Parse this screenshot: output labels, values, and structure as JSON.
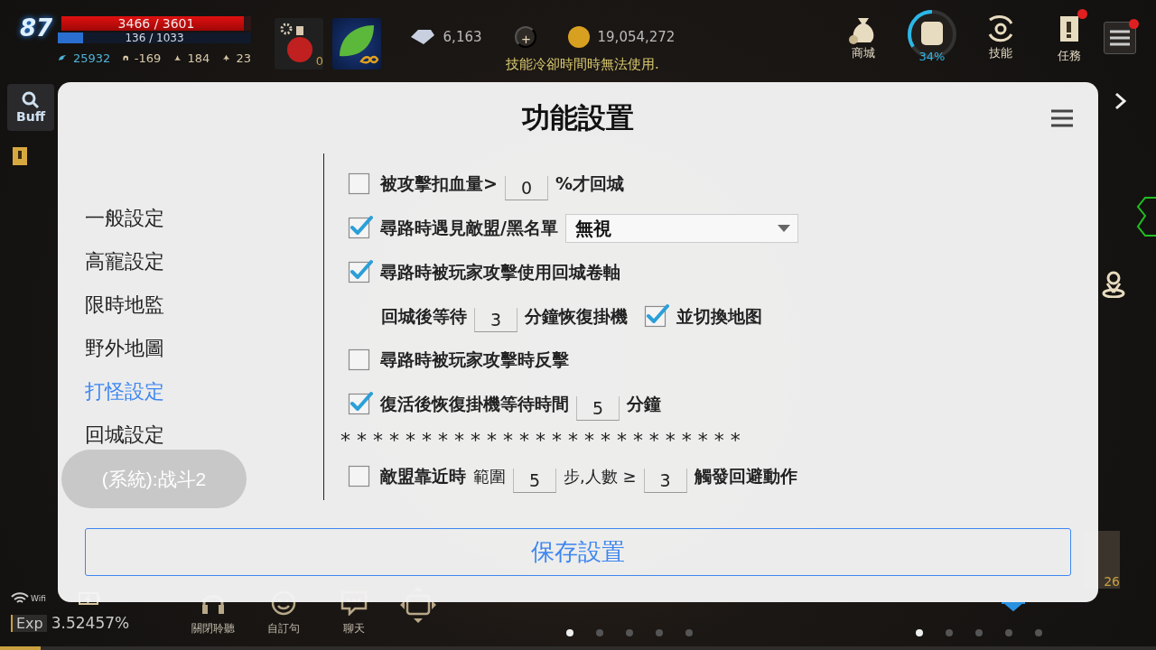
{
  "hud": {
    "level": "87",
    "hp": "3466 / 3601",
    "hp_bar": {
      "level": 0.96
    },
    "mp": "136 / 1033",
    "mp_bar": {
      "level": 0.13
    },
    "stats": [
      "25932",
      "-169",
      "184",
      "23"
    ],
    "potion_count": "0",
    "diamonds": "6,163",
    "plus": "+",
    "gold": "19,054,272",
    "message": "技能冷卻時間時無法使用.",
    "menu": [
      {
        "kind": "shop",
        "label": "商城"
      },
      {
        "kind": "bag",
        "label": "34%",
        "level": 0.34
      },
      {
        "kind": "skill",
        "label": "技能"
      },
      {
        "kind": "quest",
        "label": "任務",
        "alert": true
      },
      {
        "kind": "menu",
        "alert": true
      }
    ],
    "buff": "Buff",
    "slot_count": "26"
  },
  "dialog": {
    "title": "功能設置",
    "sidebar": [
      {
        "label": "一般設定",
        "selected": false
      },
      {
        "label": "高寵設定",
        "selected": false
      },
      {
        "label": "限時地監",
        "selected": false
      },
      {
        "label": "野外地圖",
        "selected": false
      },
      {
        "label": "打怪設定",
        "selected": true
      },
      {
        "label": "回城設定",
        "selected": false
      }
    ],
    "system_button": "(系統):战斗2",
    "rows": [
      {
        "kind": "check",
        "checked": false,
        "parts": [
          {
            "kind": "label",
            "text": "被攻擊扣血量>"
          },
          {
            "kind": "field",
            "value": "0"
          },
          {
            "kind": "label",
            "text": "%才回城"
          }
        ]
      },
      {
        "kind": "check",
        "checked": true,
        "parts": [
          {
            "kind": "label",
            "text": "尋路時遇見敵盟/黑名單"
          },
          {
            "kind": "select",
            "value": "無視"
          }
        ]
      },
      {
        "kind": "check",
        "checked": true,
        "parts": [
          {
            "kind": "label",
            "text": "尋路時被玩家攻擊使用回城卷軸"
          }
        ]
      },
      {
        "kind": "indent",
        "parts": [
          {
            "kind": "label",
            "text": "回城後等待"
          },
          {
            "kind": "field",
            "value": "3"
          },
          {
            "kind": "label",
            "text": "分鐘恢復掛機"
          },
          {
            "kind": "checkbox",
            "checked": true,
            "text": "並切換地图"
          }
        ]
      },
      {
        "kind": "check",
        "checked": false,
        "parts": [
          {
            "kind": "label",
            "text": "尋路時被玩家攻擊時反擊"
          }
        ]
      },
      {
        "kind": "check",
        "checked": true,
        "parts": [
          {
            "kind": "label",
            "text": "復活後恢復掛機等待時間"
          },
          {
            "kind": "field",
            "value": "5"
          },
          {
            "kind": "label",
            "text": "分鐘"
          }
        ]
      },
      {
        "kind": "divider",
        "text": "* * * * * * * * * * * * * * * * * * * * * * * * *"
      },
      {
        "kind": "check",
        "checked": false,
        "parts": [
          {
            "kind": "label",
            "text": "敵盟靠近時"
          },
          {
            "kind": "note",
            "text": "範圍"
          },
          {
            "kind": "field",
            "value": "5"
          },
          {
            "kind": "note",
            "text": "步,人數 ≥"
          },
          {
            "kind": "field",
            "value": "3"
          },
          {
            "kind": "label",
            "text": "觸發回避動作"
          }
        ]
      }
    ],
    "save_button": "保存設置"
  },
  "footer": {
    "wifi": "Wifi",
    "exp_label": "Exp",
    "exp_value": "3.52457%",
    "exp_bar": {
      "level": 0.035
    },
    "actions": [
      {
        "kind": "headset",
        "label": "關閉聆聽"
      },
      {
        "kind": "smile",
        "label": "自訂句"
      },
      {
        "kind": "chat",
        "label": "聊天"
      }
    ],
    "left_pages": [
      {
        "selected": true
      },
      {
        "selected": false
      },
      {
        "selected": false
      },
      {
        "selected": false
      },
      {
        "selected": false
      }
    ],
    "right_pages": [
      {
        "selected": true
      },
      {
        "selected": false
      },
      {
        "selected": false
      },
      {
        "selected": false
      },
      {
        "selected": false
      }
    ]
  }
}
